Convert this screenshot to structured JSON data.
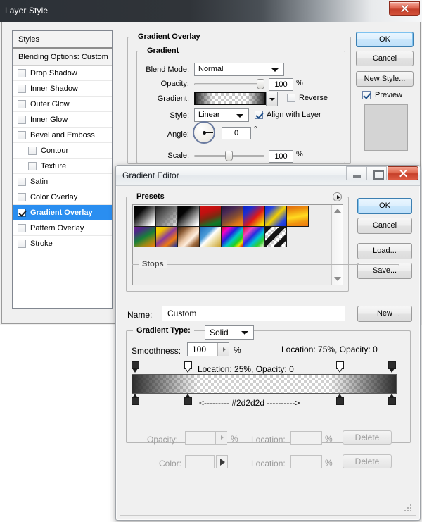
{
  "layer_style": {
    "title": "Layer Style",
    "close_icon": "close-icon",
    "styles_panel": {
      "header": "Styles",
      "blending_options": "Blending Options: Custom",
      "items": [
        {
          "label": "Drop Shadow",
          "checked": false,
          "sub": false,
          "selected": false
        },
        {
          "label": "Inner Shadow",
          "checked": false,
          "sub": false,
          "selected": false
        },
        {
          "label": "Outer Glow",
          "checked": false,
          "sub": false,
          "selected": false
        },
        {
          "label": "Inner Glow",
          "checked": false,
          "sub": false,
          "selected": false
        },
        {
          "label": "Bevel and Emboss",
          "checked": false,
          "sub": false,
          "selected": false
        },
        {
          "label": "Contour",
          "checked": false,
          "sub": true,
          "selected": false
        },
        {
          "label": "Texture",
          "checked": false,
          "sub": true,
          "selected": false
        },
        {
          "label": "Satin",
          "checked": false,
          "sub": false,
          "selected": false
        },
        {
          "label": "Color Overlay",
          "checked": false,
          "sub": false,
          "selected": false
        },
        {
          "label": "Gradient Overlay",
          "checked": true,
          "sub": false,
          "selected": true
        },
        {
          "label": "Pattern Overlay",
          "checked": false,
          "sub": false,
          "selected": false
        },
        {
          "label": "Stroke",
          "checked": false,
          "sub": false,
          "selected": false
        }
      ]
    },
    "gradient_overlay": {
      "group_title": "Gradient Overlay",
      "sub_group_title": "Gradient",
      "blend_mode_label": "Blend Mode:",
      "blend_mode_value": "Normal",
      "opacity_label": "Opacity:",
      "opacity_value": "100",
      "opacity_unit": "%",
      "gradient_label": "Gradient:",
      "reverse_label": "Reverse",
      "reverse_checked": false,
      "style_label": "Style:",
      "style_value": "Linear",
      "align_label": "Align with Layer",
      "align_checked": true,
      "angle_label": "Angle:",
      "angle_value": "0",
      "angle_unit": "°",
      "scale_label": "Scale:",
      "scale_value": "100",
      "scale_unit": "%"
    },
    "buttons": {
      "ok": "OK",
      "cancel": "Cancel",
      "new_style": "New Style...",
      "preview_label": "Preview",
      "preview_checked": true
    }
  },
  "gradient_editor": {
    "title": "Gradient Editor",
    "window_controls": {
      "minimize": "minimize-icon",
      "maximize": "maximize-icon",
      "close": "close-icon"
    },
    "presets": {
      "group_title": "Presets",
      "menu_icon": "preset-menu-icon",
      "scroll_up_icon": "scroll-up-arrow-icon",
      "scroll_down_icon": "scroll-down-arrow-icon",
      "swatches": [
        {
          "name": "black-white",
          "css": "linear-gradient(135deg,#000000 0%,#0a0a0a 28%,#7d7d7d 58%,#ffffff 88%,#ffffff 100%)"
        },
        {
          "name": "foreground-to-transparent",
          "css": "linear-gradient(135deg,#1d1d1d 0%,#6e6e6e 45%,rgba(120,120,120,0.15) 100%), repeating-conic-gradient(#cfcfcf 0% 25%, #ffffff 0% 50%) 0 0/8px 8px"
        },
        {
          "name": "black-white-2",
          "css": "linear-gradient(135deg,#000000 0%,#050505 30%,#8a8a8a 62%,#ffffff 92%)"
        },
        {
          "name": "red-green",
          "css": "linear-gradient(160deg,#d01010 0%,#c01010 30%,#7a2a10 55%,#0f7a2a 82%,#0a6b25 100%)"
        },
        {
          "name": "violet-orange",
          "css": "linear-gradient(150deg,#2b1440 0%,#4a2b55 28%,#8a5030 58%,#e07814 82%,#f08a10 100%)"
        },
        {
          "name": "blue-red-yellow",
          "css": "linear-gradient(135deg,#0a22c8 0%,#1a2fd0 22%,#e01818 56%,#f5d400 88%,#ffe800 100%)"
        },
        {
          "name": "blue-yellow-blue",
          "css": "linear-gradient(135deg,#1030d8 0%,#2a48dd 20%,#f2d000 50%,#2a48dd 80%,#1030d8 100%)"
        },
        {
          "name": "orange-yellow-orange",
          "css": "linear-gradient(170deg,#e06a10 0%,#f09a10 25%,#ffdb20 52%,#f09410 78%,#ee7a10 100%)"
        },
        {
          "name": "violet-green-orange",
          "css": "linear-gradient(150deg,#6b1f8c 0%,#4a2a84 20%,#18803a 50%,#9a8a14 75%,#ef7c10 100%)"
        },
        {
          "name": "yellow-violet-orange-blue",
          "css": "linear-gradient(140deg,#f5d800 0%,#f0c000 22%,#8b3a9c 48%,#ee7a10 72%,#1430a8 100%)"
        },
        {
          "name": "copper",
          "css": "linear-gradient(135deg,#3a2414 0%,#8a5a34 22%,#e8c4a4 46%,#ffeede 62%,#a06a3c 82%,#5c3a20 100%)"
        },
        {
          "name": "chrome",
          "css": "linear-gradient(135deg,#1c6fbc 0%,#4a9bd8 34%,#ffffff 50%,#f0e2b0 66%,#c9a230 100%)"
        },
        {
          "name": "spectrum",
          "css": "linear-gradient(135deg,#e01010 0%,#f000c8 20%,#2020e0 40%,#00c8c8 58%,#20d020 76%,#e8e800 88%,#e01010 100%)"
        },
        {
          "name": "transparent-rainbow",
          "css": "linear-gradient(135deg,#e01010 0%,#ee46c0 24%,#2a2ae0 44%,#00c0d8 62%,#30d030 80%,rgba(240,240,100,0.2) 100%), repeating-conic-gradient(#cfcfcf 0% 25%, #ffffff 0% 50%) 0 0/8px 8px"
        },
        {
          "name": "transparent-stripes",
          "css": "repeating-linear-gradient(135deg,#141414 0px,#141414 7px,rgba(255,255,255,0) 7px,rgba(255,255,255,0) 14px), repeating-conic-gradient(#cfcfcf 0% 25%, #ffffff 0% 50%) 0 0/8px 8px"
        }
      ]
    },
    "name_label": "Name:",
    "name_value": "Custom",
    "buttons": {
      "ok": "OK",
      "cancel": "Cancel",
      "load": "Load...",
      "save": "Save...",
      "new": "New"
    },
    "gradient_type": {
      "group_title": "Gradient Type:",
      "value": "Solid",
      "smoothness_label": "Smoothness:",
      "smoothness_value": "100",
      "smoothness_unit": "%"
    },
    "annotations": {
      "note_top_right": "Location: 75%, Opacity: 0",
      "note_mid_left": "Location: 25%, Opacity: 0",
      "note_hex": "<--------- #2d2d2d ---------->"
    },
    "gradient_bar": {
      "hex_color": "#2d2d2d",
      "opacity_stops": [
        {
          "position": 0,
          "opacity": 100
        },
        {
          "position": 25,
          "opacity": 0
        },
        {
          "position": 75,
          "opacity": 0
        },
        {
          "position": 100,
          "opacity": 100
        }
      ],
      "color_stops": [
        {
          "position": 0,
          "color": "#2d2d2d"
        },
        {
          "position": 25,
          "color": "#2d2d2d"
        },
        {
          "position": 75,
          "color": "#2d2d2d"
        },
        {
          "position": 100,
          "color": "#2d2d2d"
        }
      ]
    },
    "stops": {
      "group_title": "Stops",
      "opacity_label": "Opacity:",
      "opacity_value": "",
      "opacity_unit": "%",
      "opacity_location_label": "Location:",
      "opacity_location_value": "",
      "opacity_location_unit": "%",
      "delete_opacity": "Delete",
      "color_label": "Color:",
      "color_location_label": "Location:",
      "color_location_value": "",
      "color_location_unit": "%",
      "delete_color": "Delete"
    }
  }
}
